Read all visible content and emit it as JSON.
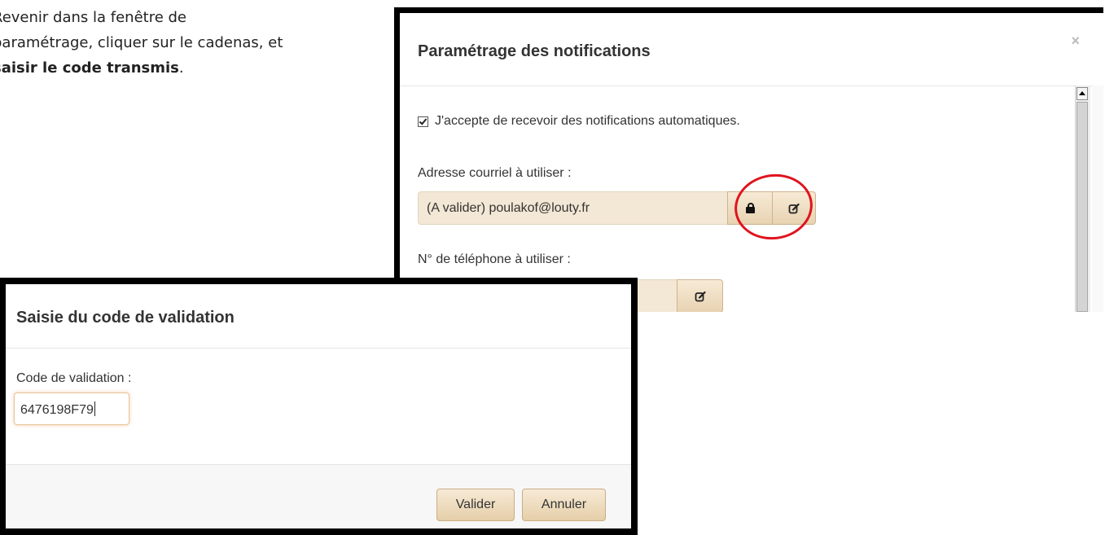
{
  "instruction": {
    "line1": "Revenir dans la fenêtre de",
    "line2": "paramétrage, cliquer sur le cadenas, et",
    "bold": "saisir le code transmis",
    "end": "."
  },
  "settings_dialog": {
    "title": "Paramétrage des notifications",
    "close_glyph": "×",
    "accept_checkbox_label": "J'accepte de recevoir des notifications automatiques.",
    "accept_checked": true,
    "email_label": "Adresse courriel à utiliser :",
    "email_value": "(A valider) poulakof@louty.fr",
    "phone_label": "N° de téléphone à utiliser :",
    "phone_value": ""
  },
  "code_dialog": {
    "title": "Saisie du code de validation",
    "code_label": "Code de validation :",
    "code_value": "6476198F79",
    "validate_button": "Valider",
    "cancel_button": "Annuler"
  },
  "colors": {
    "annotation": "#e0141e",
    "input_bg": "#f3e7d5",
    "button_bg": "#e8d3b2"
  },
  "icons": {
    "lock": "lock-icon",
    "edit": "edit-icon"
  }
}
